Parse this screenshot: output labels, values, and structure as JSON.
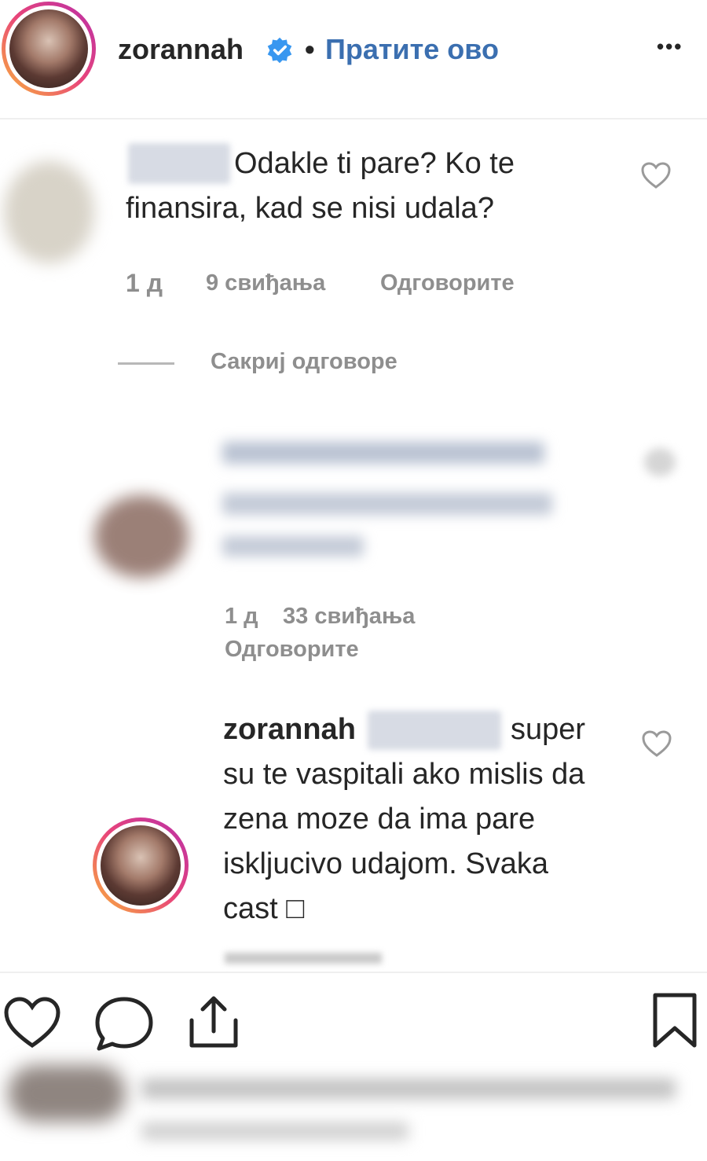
{
  "header": {
    "username": "zorannah",
    "separator": "•",
    "follow_label": "Пратите ово",
    "more_label": "•••"
  },
  "comments": [
    {
      "text": "Odakle ti pare? Ko te finansira, kad se nisi udala?",
      "time": "1 д",
      "likes": "9 свиђања",
      "reply_label": "Одговорите"
    }
  ],
  "hide_replies_label": "Сакриј одговоре",
  "replies": [
    {
      "time": "1 д",
      "likes": "33 свиђања",
      "reply_label": "Одговорите"
    },
    {
      "username": "zorannah",
      "text": "super su te vaspitali ako mislis da zena moze da ima pare iskljucivo udajom. Svaka cast □"
    }
  ],
  "icons": {
    "like": "heart-icon",
    "comment": "comment-icon",
    "share": "share-icon",
    "save": "bookmark-icon",
    "verified": "verified-badge-icon"
  },
  "colors": {
    "text": "#262626",
    "muted": "#8e8e8e",
    "link": "#3b6fb0",
    "verified": "#3897f0"
  }
}
